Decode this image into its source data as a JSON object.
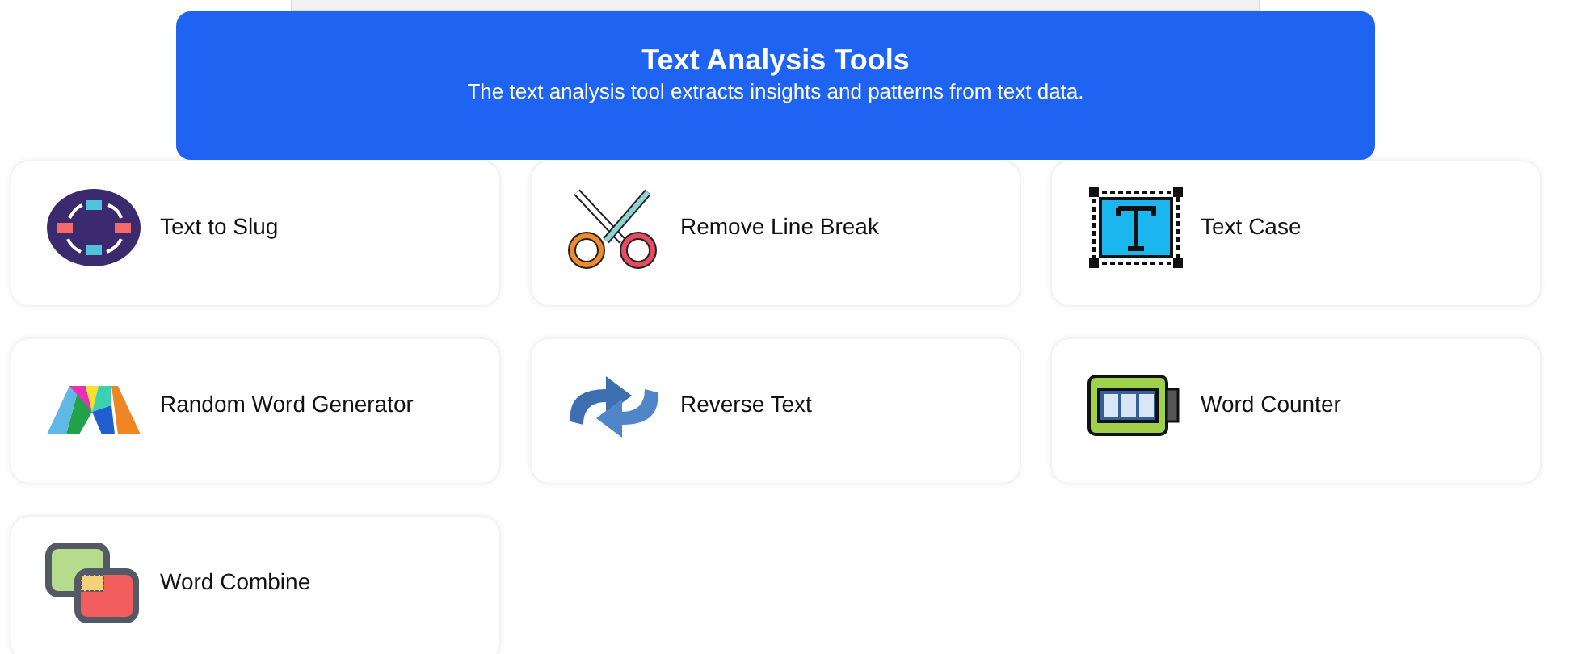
{
  "header": {
    "title": "Text Analysis Tools",
    "subtitle": "The text analysis tool extracts insights and patterns from text data."
  },
  "tools": [
    {
      "label": "Text to Slug"
    },
    {
      "label": "Remove Line Break"
    },
    {
      "label": "Text Case"
    },
    {
      "label": "Random Word Generator"
    },
    {
      "label": "Reverse Text"
    },
    {
      "label": "Word Counter"
    },
    {
      "label": "Word Combine"
    }
  ]
}
